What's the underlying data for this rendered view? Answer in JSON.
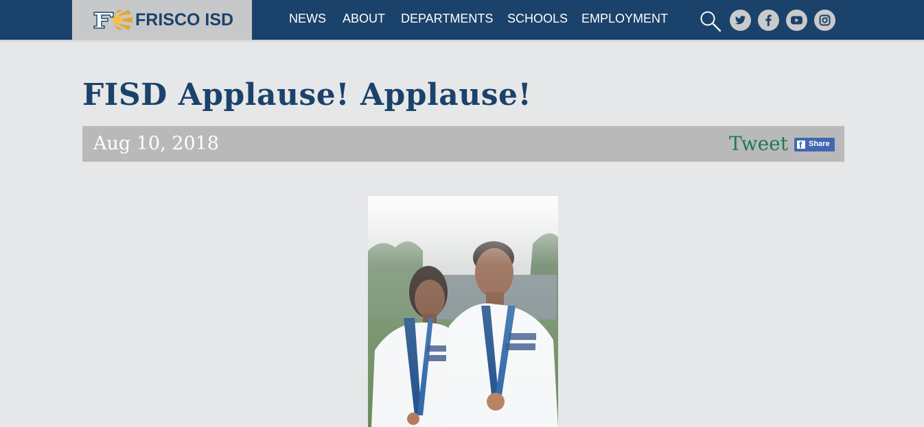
{
  "header": {
    "logo_text": "FRISCO ISD",
    "nav": [
      {
        "label": "NEWS"
      },
      {
        "label": "ABOUT"
      },
      {
        "label": "DEPARTMENTS"
      },
      {
        "label": "SCHOOLS"
      },
      {
        "label": "EMPLOYMENT"
      }
    ],
    "icons": [
      "search-icon",
      "twitter-icon",
      "facebook-icon",
      "youtube-icon",
      "instagram-icon"
    ]
  },
  "article": {
    "title": "FISD Applause! Applause!",
    "date": "Aug 10, 2018",
    "tweet_label": "Tweet",
    "share_label": "Share"
  },
  "colors": {
    "brand_navy": "#1b426a",
    "page_bg": "#e6e7e8",
    "date_bar": "#b9b9b9",
    "tweet_green": "#1a7a5c",
    "facebook_blue": "#4267b2"
  }
}
